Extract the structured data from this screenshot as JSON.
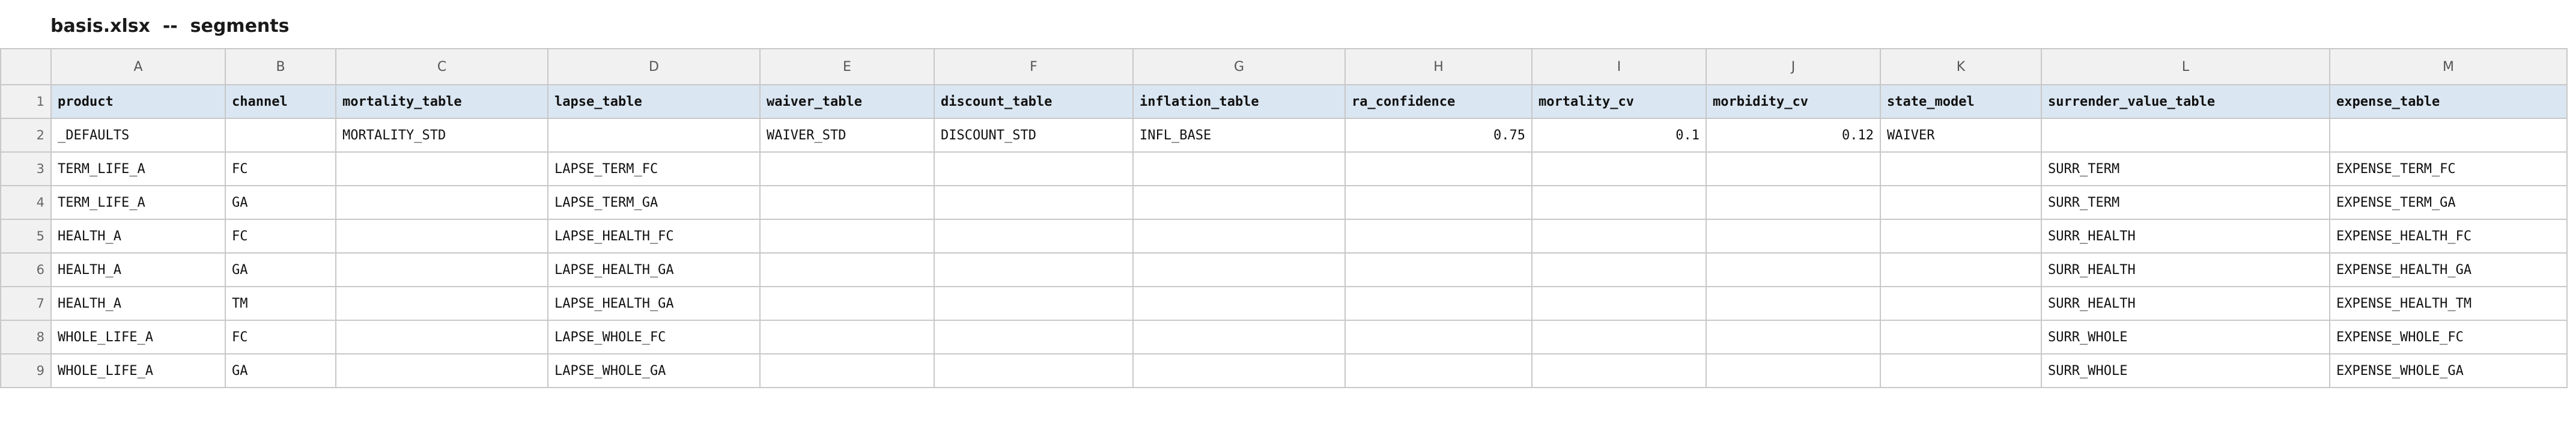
{
  "title": "basis.xlsx  --  segments",
  "columns": [
    "A",
    "B",
    "C",
    "D",
    "E",
    "F",
    "G",
    "H",
    "I",
    "J",
    "K",
    "L",
    "M"
  ],
  "rows": [
    {
      "num": "1",
      "cells": [
        "product",
        "channel",
        "mortality_table",
        "lapse_table",
        "waiver_table",
        "discount_table",
        "inflation_table",
        "ra_confidence",
        "mortality_cv",
        "morbidity_cv",
        "state_model",
        "surrender_value_table",
        "expense_table"
      ]
    },
    {
      "num": "2",
      "cells": [
        "_DEFAULTS",
        "",
        "MORTALITY_STD",
        "",
        "WAIVER_STD",
        "DISCOUNT_STD",
        "INFL_BASE",
        "0.75",
        "0.1",
        "0.12",
        "WAIVER",
        "",
        ""
      ]
    },
    {
      "num": "3",
      "cells": [
        "TERM_LIFE_A",
        "FC",
        "",
        "LAPSE_TERM_FC",
        "",
        "",
        "",
        "",
        "",
        "",
        "",
        "SURR_TERM",
        "EXPENSE_TERM_FC"
      ]
    },
    {
      "num": "4",
      "cells": [
        "TERM_LIFE_A",
        "GA",
        "",
        "LAPSE_TERM_GA",
        "",
        "",
        "",
        "",
        "",
        "",
        "",
        "SURR_TERM",
        "EXPENSE_TERM_GA"
      ]
    },
    {
      "num": "5",
      "cells": [
        "HEALTH_A",
        "FC",
        "",
        "LAPSE_HEALTH_FC",
        "",
        "",
        "",
        "",
        "",
        "",
        "",
        "SURR_HEALTH",
        "EXPENSE_HEALTH_FC"
      ]
    },
    {
      "num": "6",
      "cells": [
        "HEALTH_A",
        "GA",
        "",
        "LAPSE_HEALTH_GA",
        "",
        "",
        "",
        "",
        "",
        "",
        "",
        "SURR_HEALTH",
        "EXPENSE_HEALTH_GA"
      ]
    },
    {
      "num": "7",
      "cells": [
        "HEALTH_A",
        "TM",
        "",
        "LAPSE_HEALTH_GA",
        "",
        "",
        "",
        "",
        "",
        "",
        "",
        "SURR_HEALTH",
        "EXPENSE_HEALTH_TM"
      ]
    },
    {
      "num": "8",
      "cells": [
        "WHOLE_LIFE_A",
        "FC",
        "",
        "LAPSE_WHOLE_FC",
        "",
        "",
        "",
        "",
        "",
        "",
        "",
        "SURR_WHOLE",
        "EXPENSE_WHOLE_FC"
      ]
    },
    {
      "num": "9",
      "cells": [
        "WHOLE_LIFE_A",
        "GA",
        "",
        "LAPSE_WHOLE_GA",
        "",
        "",
        "",
        "",
        "",
        "",
        "",
        "SURR_WHOLE",
        "EXPENSE_WHOLE_GA"
      ]
    }
  ]
}
